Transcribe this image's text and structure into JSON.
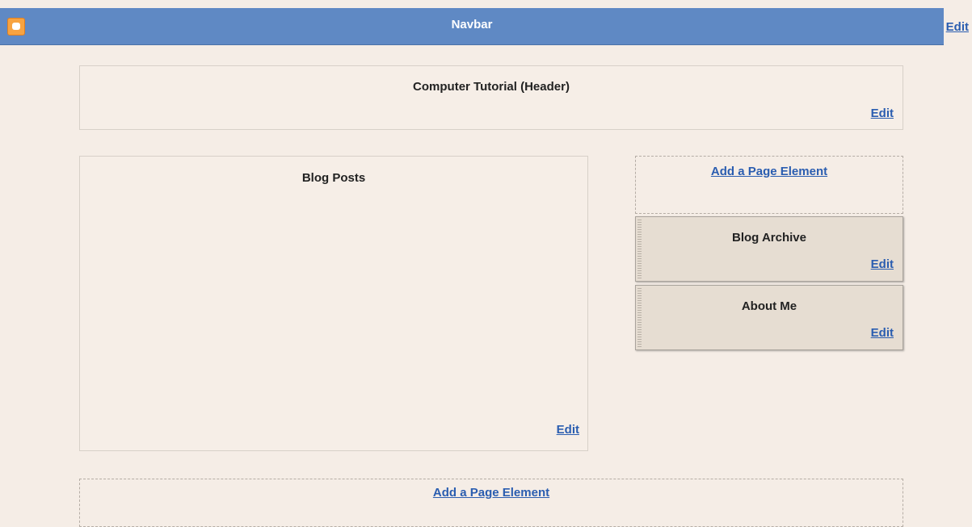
{
  "navbar": {
    "title": "Navbar",
    "edit_label": "Edit"
  },
  "header": {
    "title": "Computer Tutorial (Header)",
    "edit_label": "Edit"
  },
  "main": {
    "title": "Blog Posts",
    "edit_label": "Edit"
  },
  "sidebar": {
    "add_label": "Add a Page Element",
    "widgets": [
      {
        "title": "Blog Archive",
        "edit_label": "Edit"
      },
      {
        "title": "About Me",
        "edit_label": "Edit"
      }
    ]
  },
  "footer": {
    "add_label": "Add a Page Element"
  }
}
